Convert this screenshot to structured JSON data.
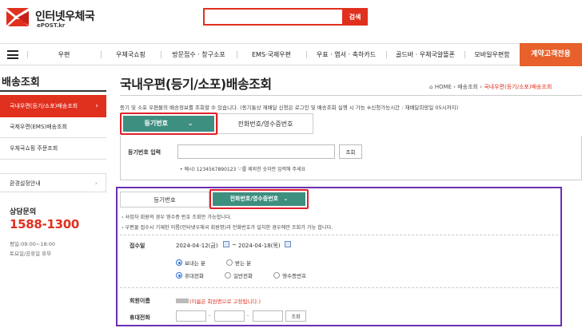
{
  "header": {
    "logo_text": "인터넷우체국",
    "logo_sub": "ePOST.kr",
    "search_placeholder": "",
    "search_button": "검색"
  },
  "nav": {
    "items": [
      "우편",
      "우체국쇼핑",
      "방문접수 · 창구소포",
      "EMS·국제우편",
      "우표 · 엽서 · 축하카드",
      "골드바 · 우체국알뜰폰",
      "모바일우편함"
    ],
    "cta": "계약고객전용"
  },
  "sidebar": {
    "title": "배송조회",
    "items": [
      {
        "label": "국내우편(등기/소포)배송조회",
        "active": true
      },
      {
        "label": "국제우편(EMS)배송조회",
        "active": false
      },
      {
        "label": "우체국쇼핑 주문조회",
        "active": false
      }
    ],
    "settings": "환경설정안내",
    "cs_title": "상담문의",
    "cs_phone": "1588-1300",
    "cs_hours": "평일:09:00~18:00",
    "cs_holiday": "토요일/공휴일 휴무"
  },
  "main": {
    "title": "국내우편(등기/소포)배송조회",
    "breadcrumb": [
      "HOME",
      "배송조회",
      "국내우편(등기/소포)배송조회"
    ],
    "description": "등기 및 소포 우편물의 배송정보를 조회할 수 있습니다. (등기통상 재배달 신청은 로그인 및 배송조회 실행 시 가능 ※신청가능시간 : 재배달희망일 05시까지)",
    "tabs": {
      "registered": "등기번호",
      "phone": "전화번호/영수증번호"
    },
    "reg_form": {
      "label": "등기번호 입력",
      "button": "조회",
      "note": "• 예시) 1234567890123 '-'를 제외한 숫자만 입력해 주세요"
    },
    "phone_panel": {
      "tab_registered": "등기번호",
      "tab_phone": "전화번호/영수증번호",
      "bullet1": "› 사업자 회원의 경우 영수증 번호 조회만 가능합니다.",
      "bullet2": "› 우편물 접수시 기재한 이름(인터넷우체국 회원명)과 전화번호가 일치한 경우에만 조회가 가능 합니다.",
      "date_label": "접수일",
      "date_from": "2024-04-12(금)",
      "date_sep": "~",
      "date_to": "2024-04-18(목)",
      "radio_sender": "보내는 분",
      "radio_receiver": "받는 분",
      "radio_mobile": "휴대전화",
      "radio_landline": "일반전화",
      "radio_receipt": "영수증번호",
      "member_label": "회원이름",
      "member_note": "(이름은 회원명으로 고정됩니다.)",
      "mobile_label": "휴대전화",
      "phone_sep": "-",
      "query_button": "조회"
    }
  }
}
